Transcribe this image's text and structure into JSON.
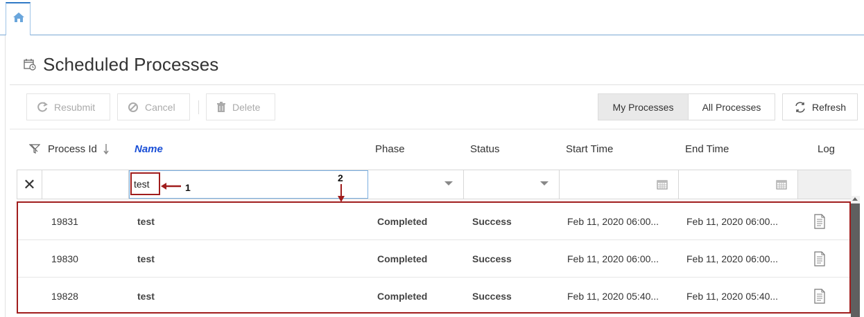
{
  "header": {
    "title": "Scheduled Processes"
  },
  "toolbar": {
    "resubmit_label": "Resubmit",
    "cancel_label": "Cancel",
    "delete_label": "Delete",
    "my_processes_label": "My Processes",
    "all_processes_label": "All Processes",
    "refresh_label": "Refresh"
  },
  "table": {
    "columns": [
      "Process Id",
      "Name",
      "Phase",
      "Status",
      "Start Time",
      "End Time",
      "Log"
    ],
    "sorted_column": "Name",
    "filters": {
      "name_value": "test"
    },
    "rows": [
      {
        "id": "19831",
        "name": "test",
        "phase": "Completed",
        "status": "Success",
        "start": "Feb 11, 2020 06:00...",
        "end": "Feb 11, 2020 06:00..."
      },
      {
        "id": "19830",
        "name": "test",
        "phase": "Completed",
        "status": "Success",
        "start": "Feb 11, 2020 06:00...",
        "end": "Feb 11, 2020 06:00..."
      },
      {
        "id": "19828",
        "name": "test",
        "phase": "Completed",
        "status": "Success",
        "start": "Feb 11, 2020 05:40...",
        "end": "Feb 11, 2020 05:40..."
      }
    ]
  },
  "annotations": {
    "label_1": "1",
    "label_2": "2"
  },
  "colors": {
    "accent_blue": "#2f79c6",
    "sorted_header": "#1a4fd6",
    "annotation_red": "#a01c1c"
  },
  "icons": [
    "home-icon",
    "calendar-clock-icon",
    "resubmit-icon",
    "cancel-icon",
    "delete-icon",
    "refresh-icon",
    "filter-icon",
    "sort-down-icon",
    "calendar-icon",
    "log-document-icon"
  ]
}
